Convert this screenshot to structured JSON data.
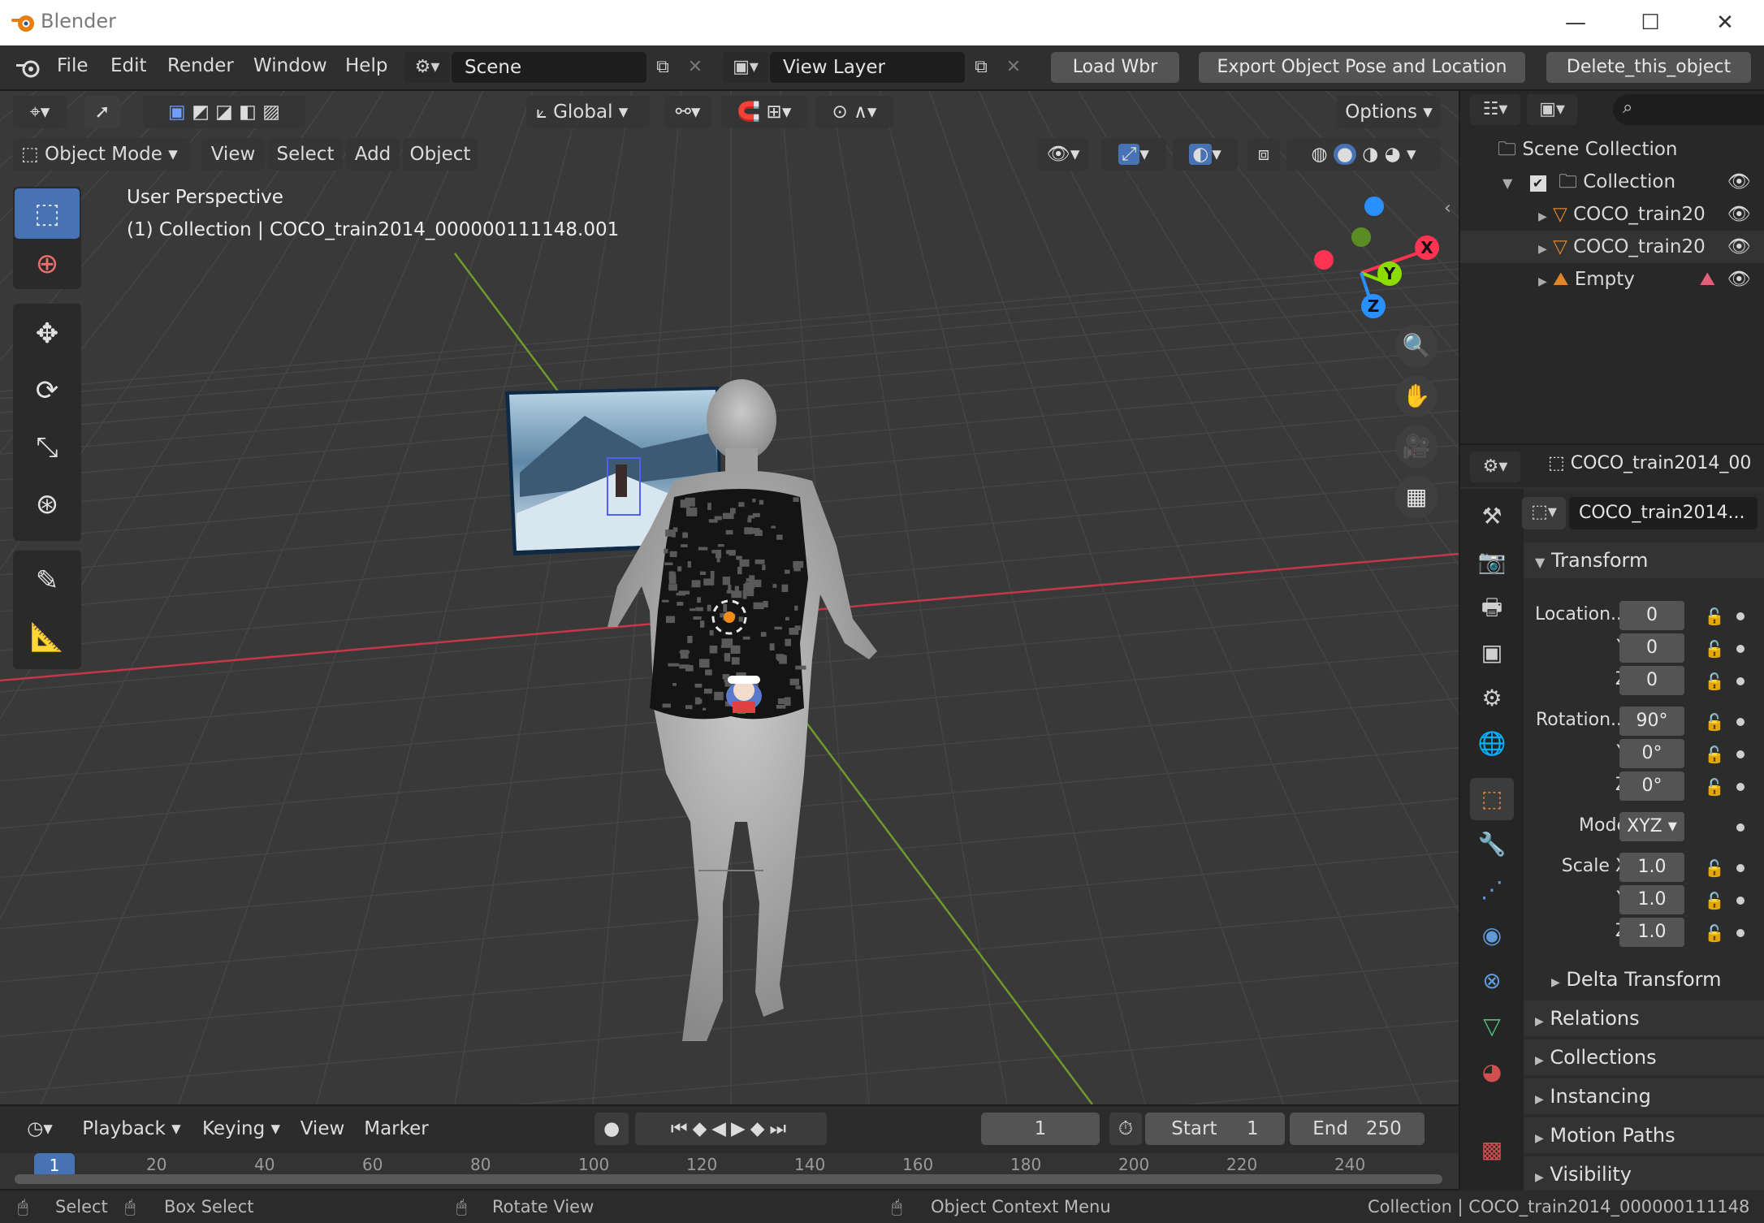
{
  "window": {
    "title": "Blender",
    "icons": [
      "blender-logo-icon",
      "minimize-icon",
      "maximize-icon",
      "close-icon"
    ]
  },
  "menubar": {
    "items": [
      "File",
      "Edit",
      "Render",
      "Window",
      "Help"
    ],
    "scene": "Scene",
    "view_layer": "View Layer",
    "buttons": [
      "Load Wbr",
      "Export Object Pose and Location",
      "Delete_this_object"
    ]
  },
  "viewport_header": {
    "orientation": "Global",
    "options": "Options",
    "mode": "Object Mode",
    "menus": [
      "View",
      "Select",
      "Add",
      "Object"
    ]
  },
  "viewport": {
    "perspective": "User Perspective",
    "info": "(1) Collection | COCO_train2014_000000111148.001",
    "gizmo_axes": [
      "X",
      "Y",
      "Z"
    ]
  },
  "outliner": {
    "root": "Scene Collection",
    "collection": "Collection",
    "items": [
      "COCO_train20",
      "COCO_train20",
      "Empty"
    ]
  },
  "properties": {
    "object_name": "COCO_train2014_00",
    "data_name": "COCO_train2014...",
    "transform_title": "Transform",
    "location_label": "Location...",
    "location": [
      "0",
      "0",
      "0"
    ],
    "rotation_label": "Rotation...",
    "rotation": [
      "90°",
      "0°",
      "0°"
    ],
    "mode_label": "Mode",
    "mode": "XYZ",
    "scale_label": "Scale X",
    "scale": [
      "1.0",
      "1.0",
      "1.0"
    ],
    "axis_labels": [
      "Y",
      "Z"
    ],
    "subpanel": "Delta Transform",
    "panels": [
      "Relations",
      "Collections",
      "Instancing",
      "Motion Paths",
      "Visibility"
    ]
  },
  "timeline": {
    "menus": [
      "Playback",
      "Keying",
      "View",
      "Marker"
    ],
    "current_frame": "1",
    "start_label": "Start",
    "start": "1",
    "end_label": "End",
    "end": "250",
    "ruler": [
      "1",
      "20",
      "40",
      "60",
      "80",
      "100",
      "120",
      "140",
      "160",
      "180",
      "200",
      "220",
      "240"
    ]
  },
  "statusbar": {
    "select": "Select",
    "box_select": "Box Select",
    "rotate_view": "Rotate View",
    "context_menu": "Object Context Menu",
    "info": "Collection | COCO_train2014_000000111148"
  },
  "colors": {
    "accent_blue": "#4772b3",
    "x_axis": "#ff3352",
    "y_axis": "#8bdc00",
    "z_axis": "#2890ff",
    "orange": "#e0852b"
  }
}
